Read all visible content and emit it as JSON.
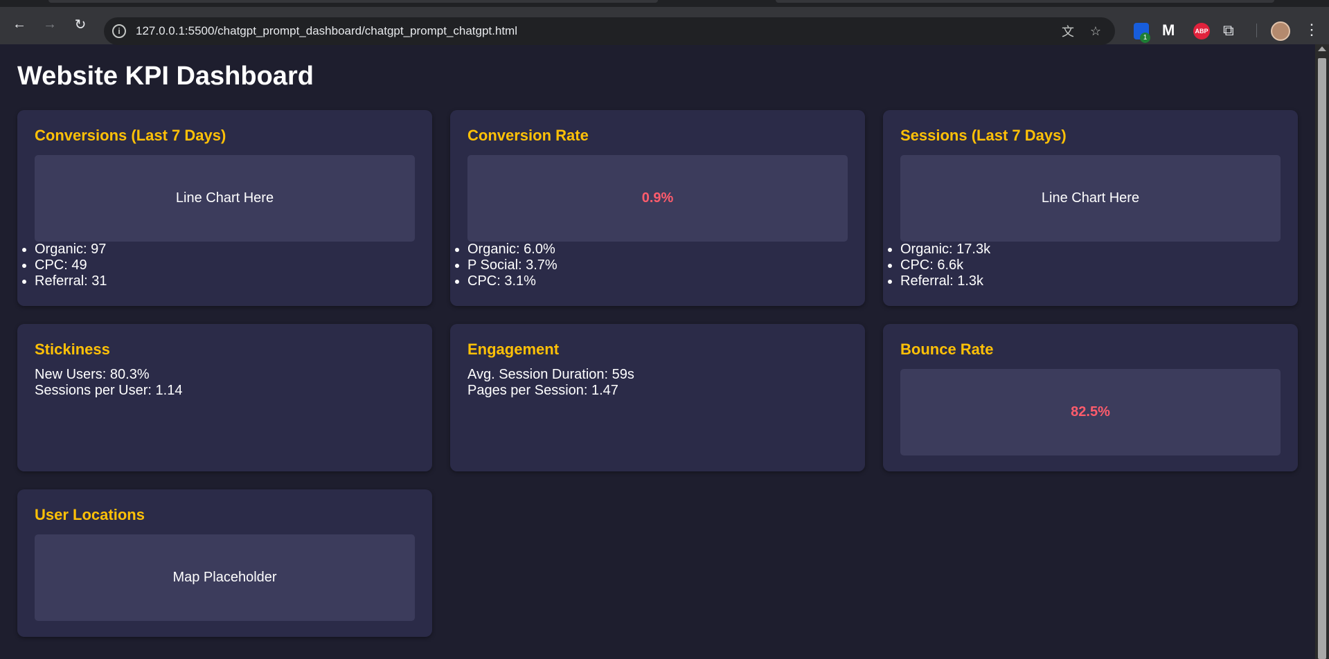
{
  "browser": {
    "url": "127.0.0.1:5500/chatgpt_prompt_dashboard/chatgpt_prompt_chatgpt.html",
    "extension_badge": "1",
    "abp_label": "ABP"
  },
  "dashboard": {
    "title": "Website KPI Dashboard",
    "cards": {
      "conversions": {
        "title": "Conversions (Last 7 Days)",
        "chart_placeholder": "Line Chart Here",
        "items": [
          "Organic: 97",
          "CPC: 49",
          "Referral: 31"
        ]
      },
      "conversion_rate": {
        "title": "Conversion Rate",
        "metric": "0.9%",
        "items": [
          "Organic: 6.0%",
          "P Social: 3.7%",
          "CPC: 3.1%"
        ]
      },
      "sessions": {
        "title": "Sessions (Last 7 Days)",
        "chart_placeholder": "Line Chart Here",
        "items": [
          "Organic: 17.3k",
          "CPC: 6.6k",
          "Referral: 1.3k"
        ]
      },
      "stickiness": {
        "title": "Stickiness",
        "lines": [
          "New Users: 80.3%",
          "Sessions per User: 1.14"
        ]
      },
      "engagement": {
        "title": "Engagement",
        "lines": [
          "Avg. Session Duration: 59s",
          "Pages per Session: 1.47"
        ]
      },
      "bounce_rate": {
        "title": "Bounce Rate",
        "metric": "82.5%"
      },
      "user_locations": {
        "title": "User Locations",
        "map_placeholder": "Map Placeholder"
      }
    }
  },
  "colors": {
    "page_bg": "#1e1e2e",
    "card_bg": "#2b2b48",
    "placeholder_bg": "#3c3c5c",
    "accent_title": "#ffc107",
    "metric_red": "#ff5c6c"
  }
}
